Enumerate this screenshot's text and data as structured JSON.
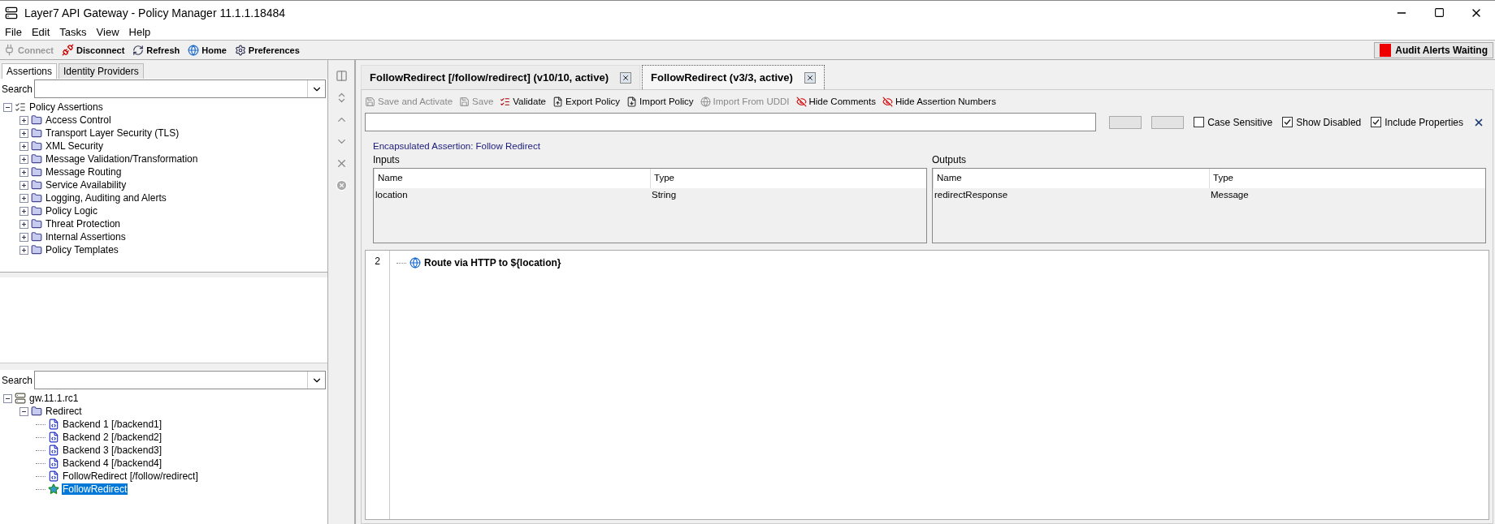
{
  "window": {
    "title": "Layer7 API Gateway - Policy Manager 11.1.1.18484"
  },
  "menu": [
    "File",
    "Edit",
    "Tasks",
    "View",
    "Help"
  ],
  "toolbar": [
    {
      "label": "Connect",
      "kind": "connect",
      "disabled": true
    },
    {
      "label": "Disconnect",
      "kind": "disconnect",
      "disabled": false
    },
    {
      "label": "Refresh",
      "kind": "refresh",
      "disabled": false
    },
    {
      "label": "Home",
      "kind": "home",
      "disabled": false
    },
    {
      "label": "Preferences",
      "kind": "preferences",
      "disabled": false
    }
  ],
  "alert_button": {
    "label": "Audit Alerts Waiting"
  },
  "left_tabs": [
    {
      "label": "Assertions",
      "selected": true
    },
    {
      "label": "Identity Providers",
      "selected": false
    }
  ],
  "assertion_search": {
    "label": "Search"
  },
  "assertion_tree": {
    "label": "Policy Assertions",
    "expanded": true,
    "children": [
      {
        "label": "Access Control",
        "expanded": false
      },
      {
        "label": "Transport Layer Security (TLS)",
        "expanded": false
      },
      {
        "label": "XML Security",
        "expanded": false
      },
      {
        "label": "Message Validation/Transformation",
        "expanded": false
      },
      {
        "label": "Message Routing",
        "expanded": false
      },
      {
        "label": "Service Availability",
        "expanded": false
      },
      {
        "label": "Logging, Auditing and Alerts",
        "expanded": false
      },
      {
        "label": "Policy Logic",
        "expanded": false
      },
      {
        "label": "Threat Protection",
        "expanded": false
      },
      {
        "label": "Internal Assertions",
        "expanded": false
      },
      {
        "label": "Policy Templates",
        "expanded": false
      }
    ]
  },
  "service_search": {
    "label": "Search"
  },
  "service_tree": {
    "label": "gw.11.1.rc1",
    "expanded": true,
    "children": [
      {
        "label": "Redirect",
        "expanded": true,
        "children": [
          {
            "label": "Backend 1 [/backend1]",
            "kind": "policy",
            "selected": false
          },
          {
            "label": "Backend 2 [/backend2]",
            "kind": "policy",
            "selected": false
          },
          {
            "label": "Backend 3 [/backend3]",
            "kind": "policy",
            "selected": false
          },
          {
            "label": "Backend 4 [/backend4]",
            "kind": "policy",
            "selected": false
          },
          {
            "label": "FollowRedirect [/follow/redirect]",
            "kind": "policy",
            "selected": false
          },
          {
            "label": "FollowRedirect",
            "kind": "encass",
            "selected": true
          }
        ]
      }
    ]
  },
  "editor_tabs": [
    {
      "label": "FollowRedirect [/follow/redirect] (v10/10, active)",
      "selected": false
    },
    {
      "label": "FollowRedirect (v3/3, active)",
      "selected": true
    }
  ],
  "policy_toolbar": [
    {
      "label": "Save and Activate",
      "kind": "save",
      "disabled": true
    },
    {
      "label": "Save",
      "kind": "save",
      "disabled": true
    },
    {
      "label": "Validate",
      "kind": "validate",
      "disabled": false
    },
    {
      "label": "Export Policy",
      "kind": "export",
      "disabled": false
    },
    {
      "label": "Import Policy",
      "kind": "import",
      "disabled": false
    },
    {
      "label": "Import From UDDI",
      "kind": "uddi",
      "disabled": true
    },
    {
      "label": "Hide Comments",
      "kind": "hide",
      "disabled": false
    },
    {
      "label": "Hide Assertion Numbers",
      "kind": "hide",
      "disabled": false
    }
  ],
  "find_options": [
    {
      "label": "Case Sensitive",
      "checked": false
    },
    {
      "label": "Show Disabled",
      "checked": true
    },
    {
      "label": "Include Properties",
      "checked": true
    }
  ],
  "encapsulated_title": "Encapsulated Assertion: Follow Redirect",
  "inputs": {
    "label": "Inputs",
    "columns": [
      "Name",
      "Type"
    ],
    "rows": [
      [
        "location",
        "String"
      ]
    ]
  },
  "outputs": {
    "label": "Outputs",
    "columns": [
      "Name",
      "Type"
    ],
    "rows": [
      [
        "redirectResponse",
        "Message"
      ]
    ]
  },
  "policy_lines": [
    {
      "number": "2",
      "text": "Route via HTTP to ${location}"
    }
  ]
}
